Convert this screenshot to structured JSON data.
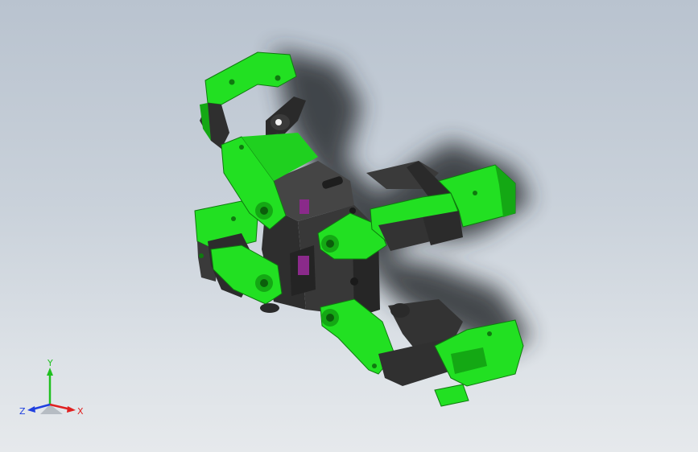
{
  "viewport": {
    "background_top": "#b9c3cf",
    "background_bottom": "#e6e9ec"
  },
  "model": {
    "part_color": "#22e022",
    "part_color_dark": "#14a814",
    "frame_color": "#3a3a3a",
    "frame_color_dark": "#242424",
    "connector_color": "#8a2a8a",
    "shadow_color": "#2a2e33"
  },
  "triad": {
    "x_label": "X",
    "y_label": "Y",
    "z_label": "Z",
    "x_color": "#e02020",
    "y_color": "#20c020",
    "z_color": "#2040e0"
  }
}
